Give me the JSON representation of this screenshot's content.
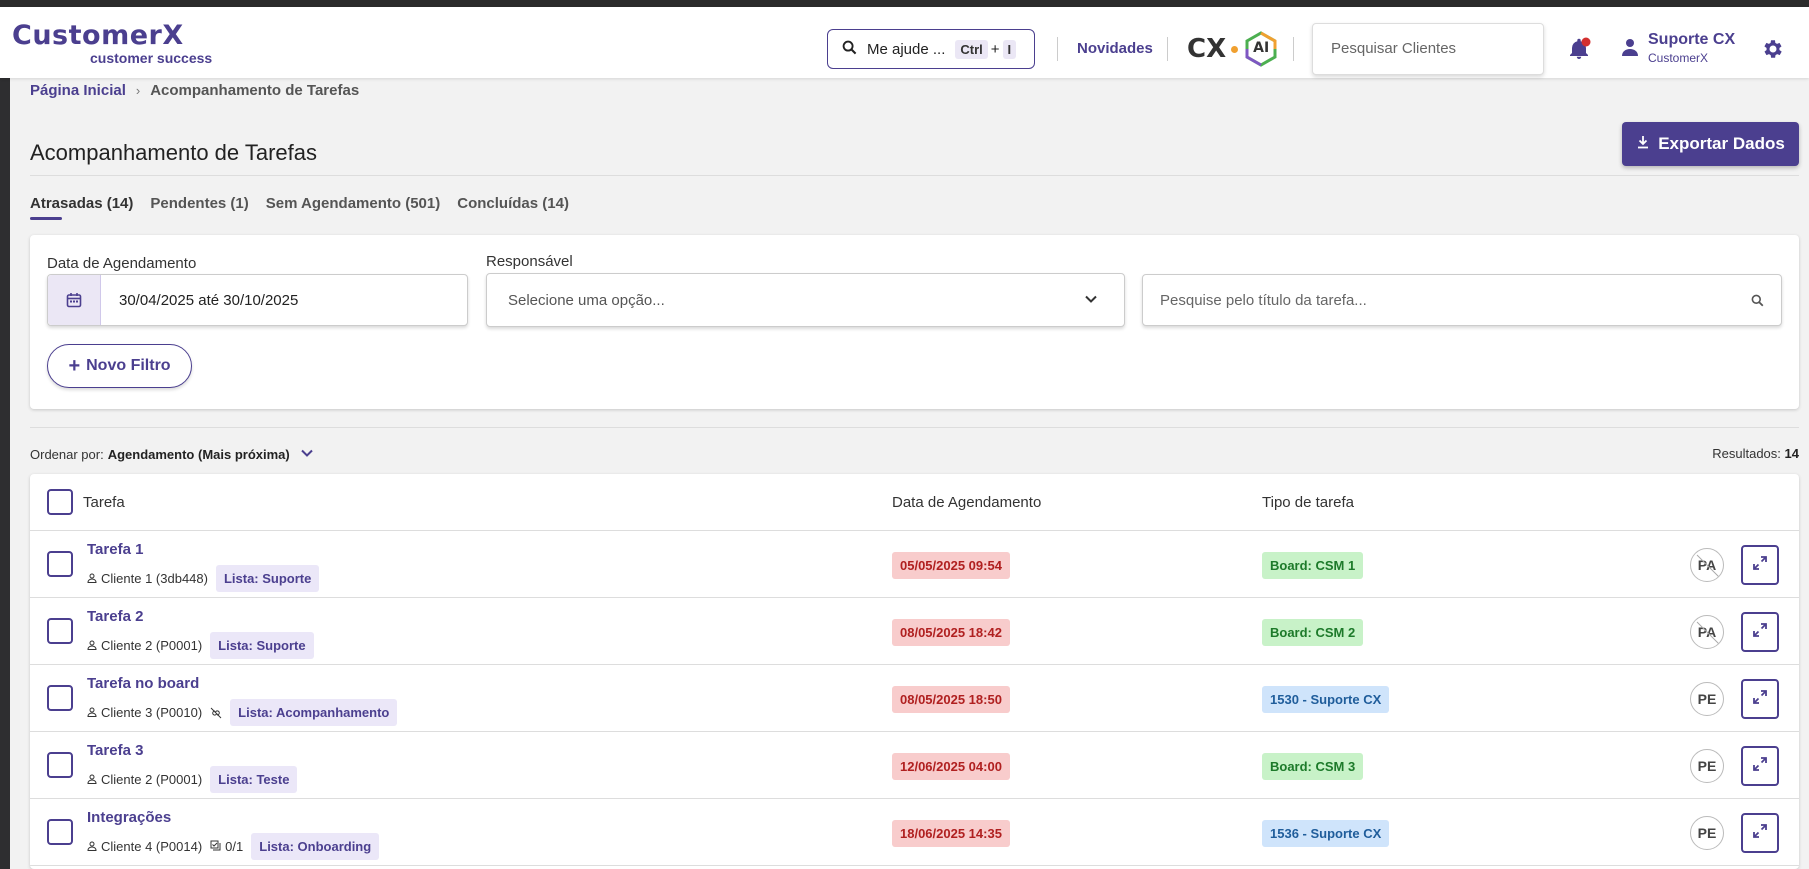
{
  "header": {
    "logo_main": "CustomerX",
    "logo_sub": "customer success",
    "help_text": "Me ajude ...",
    "help_kbd_ctrl": "Ctrl",
    "help_kbd_plus": "+",
    "help_kbd_key": "I",
    "news_label": "Novidades",
    "cx_label": "CX",
    "ai_label": "AI",
    "search_placeholder": "Pesquisar Clientes",
    "user_name": "Suporte CX",
    "user_company": "CustomerX"
  },
  "breadcrumb": {
    "home": "Página Inicial",
    "separator": "›",
    "current": "Acompanhamento de Tarefas"
  },
  "page": {
    "title": "Acompanhamento de Tarefas",
    "export_label": "Exportar Dados"
  },
  "tabs": [
    {
      "label": "Atrasadas (14)",
      "active": true
    },
    {
      "label": "Pendentes (1)",
      "active": false
    },
    {
      "label": "Sem Agendamento (501)",
      "active": false
    },
    {
      "label": "Concluídas (14)",
      "active": false
    }
  ],
  "filters": {
    "date_label": "Data de Agendamento",
    "date_value": "30/04/2025 até 30/10/2025",
    "responsible_label": "Responsável",
    "responsible_placeholder": "Selecione uma opção...",
    "title_search_placeholder": "Pesquise pelo título da tarefa...",
    "new_filter_plus": "+",
    "new_filter_label": "Novo Filtro"
  },
  "list": {
    "order_prefix": "Ordenar por:",
    "order_value": "Agendamento (Mais próxima)",
    "results_prefix": "Resultados:",
    "results_count": "14"
  },
  "table": {
    "headers": {
      "task": "Tarefa",
      "date": "Data de Agendamento",
      "type": "Tipo de tarefa"
    },
    "rows": [
      {
        "name": "Tarefa 1",
        "client": "Cliente 1 (3db448)",
        "extra": "",
        "list": "Lista: Suporte",
        "date": "05/05/2025 09:54",
        "type": "Board: CSM 1",
        "type_color": "green",
        "avatar": "PA",
        "avatar_struck": true
      },
      {
        "name": "Tarefa 2",
        "client": "Cliente 2 (P0001)",
        "extra": "",
        "list": "Lista: Suporte",
        "date": "08/05/2025 18:42",
        "type": "Board: CSM 2",
        "type_color": "green",
        "avatar": "PA",
        "avatar_struck": true
      },
      {
        "name": "Tarefa no board",
        "client": "Cliente 3 (P0010)",
        "extra": "",
        "extra_icon": "unlink-icon",
        "list": "Lista: Acompanhamento",
        "date": "08/05/2025 18:50",
        "type": "1530 - Suporte CX",
        "type_color": "blue",
        "avatar": "PE",
        "avatar_struck": false
      },
      {
        "name": "Tarefa 3",
        "client": "Cliente 2 (P0001)",
        "extra": "",
        "list": "Lista: Teste",
        "date": "12/06/2025 04:00",
        "type": "Board: CSM 3",
        "type_color": "green",
        "avatar": "PE",
        "avatar_struck": false
      },
      {
        "name": "Integrações",
        "client": "Cliente 4 (P0014)",
        "extra": "0/1",
        "extra_icon": "checklist-icon",
        "list": "Lista: Onboarding",
        "date": "18/06/2025 14:35",
        "type": "1536 - Suporte CX",
        "type_color": "blue",
        "avatar": "PE",
        "avatar_struck": false
      }
    ]
  },
  "colors": {
    "brand": "#4b3f8f",
    "date_chip_bg": "#f8cccc",
    "green_chip_bg": "#c8f2c8",
    "blue_chip_bg": "#cfe4fb"
  },
  "icons": [
    "search-icon",
    "bell-icon",
    "user-icon",
    "gear-icon",
    "download-icon",
    "calendar-icon",
    "chevron-down-icon",
    "person-icon",
    "unlink-icon",
    "checklist-icon",
    "expand-icon"
  ]
}
